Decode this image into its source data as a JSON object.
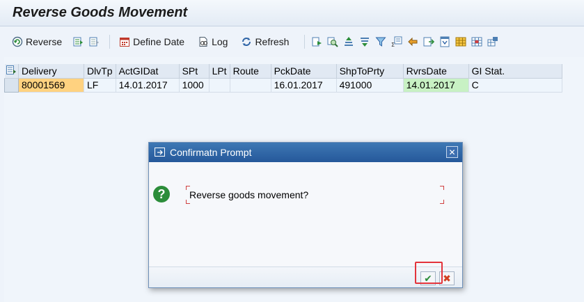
{
  "window": {
    "title": "Reverse Goods Movement"
  },
  "toolbar": {
    "reverse_label": "Reverse",
    "define_date_label": "Define Date",
    "log_label": "Log",
    "refresh_label": "Refresh"
  },
  "table": {
    "columns": [
      "Delivery",
      "DlvTp",
      "ActGIDat",
      "SPt",
      "LPt",
      "Route",
      "PckDate",
      "ShpToPrty",
      "RvrsDate",
      "GI Stat."
    ],
    "rows": [
      [
        "80001569",
        "LF",
        "14.01.2017",
        "1000",
        "",
        "",
        "16.01.2017",
        "491000",
        "14.01.2017",
        "C"
      ]
    ]
  },
  "dialog": {
    "title": "Confirmatn Prompt",
    "message": "Reverse goods movement?",
    "ok_label": "✔",
    "cancel_label": "✖"
  },
  "colors": {
    "key_field": "#ffd280",
    "date_highlight": "#c8f1c4",
    "dialog_header": "#2e64a6",
    "highlight_frame": "#e3333b"
  }
}
